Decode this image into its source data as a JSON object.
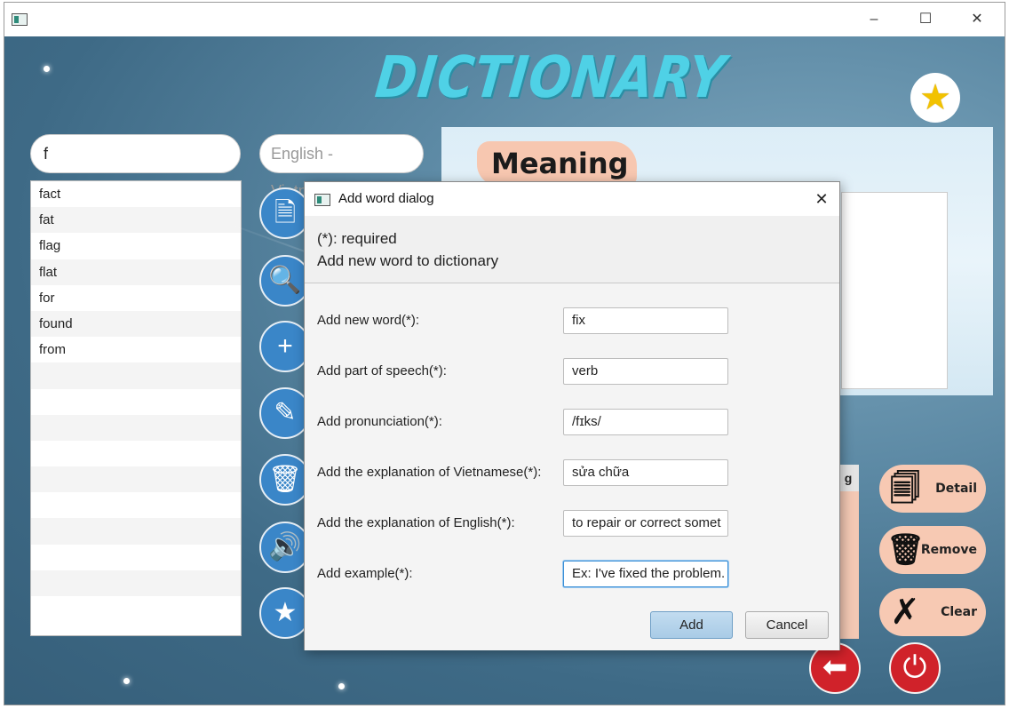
{
  "window": {
    "minimize_glyph": "–",
    "maximize_glyph": "☐",
    "close_glyph": "✕"
  },
  "app": {
    "logo": "DICTIONARY",
    "favorite_glyph": "★"
  },
  "search": {
    "value": "f"
  },
  "language": {
    "value": "English - Vietnamese"
  },
  "word_list": [
    "fact",
    "fat",
    "flag",
    "flat",
    "for",
    "found",
    "from",
    "",
    "",
    "",
    "",
    "",
    "",
    "",
    "",
    "",
    ""
  ],
  "side_buttons": [
    {
      "name": "document-search-icon",
      "glyph": "🗎"
    },
    {
      "name": "search-icon",
      "glyph": "🔍"
    },
    {
      "name": "add-icon",
      "glyph": "+"
    },
    {
      "name": "edit-icon",
      "glyph": "✎"
    },
    {
      "name": "delete-icon",
      "glyph": "🗑"
    },
    {
      "name": "speaker-icon",
      "glyph": "🔊"
    },
    {
      "name": "star-icon",
      "glyph": "★"
    }
  ],
  "meaning": {
    "title": "Meaning"
  },
  "peach_label": "g",
  "actions": {
    "detail": {
      "label": "Detail",
      "glyph": "🗐"
    },
    "remove": {
      "label": "Remove",
      "glyph": "🗑"
    },
    "clear": {
      "label": "Clear",
      "glyph": "✗"
    }
  },
  "bottom": {
    "back_glyph": "⬅",
    "power_glyph": "⏻"
  },
  "dialog": {
    "title": "Add word dialog",
    "close_glyph": "✕",
    "required_note": "(*): required",
    "header": "Add new word to dictionary",
    "fields": [
      {
        "label": "Add new word(*):",
        "value": "fix"
      },
      {
        "label": "Add part of speech(*):",
        "value": "verb"
      },
      {
        "label": "Add pronunciation(*):",
        "value": "/fɪks/"
      },
      {
        "label": "Add the explanation of Vietnamese(*):",
        "value": "sửa chữa"
      },
      {
        "label": "Add the explanation of English(*):",
        "value": "to repair or correct somet"
      },
      {
        "label": "Add example(*):",
        "value": "Ex: I've fixed the problem."
      }
    ],
    "add_label": "Add",
    "cancel_label": "Cancel"
  }
}
